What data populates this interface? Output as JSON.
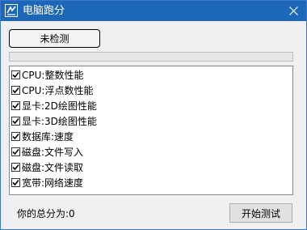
{
  "window": {
    "title": "电脑跑分",
    "app_icon": "app-logo-icon",
    "close_icon": "close-icon"
  },
  "status_button": {
    "label": "未检测"
  },
  "progress": {
    "value_fraction": 0
  },
  "tests": [
    {
      "label": "CPU:整数性能",
      "checked": true
    },
    {
      "label": "CPU:浮点数性能",
      "checked": true
    },
    {
      "label": "显卡:2D绘图性能",
      "checked": true
    },
    {
      "label": "显卡:3D绘图性能",
      "checked": true
    },
    {
      "label": "数据库:速度",
      "checked": true
    },
    {
      "label": "磁盘:文件写入",
      "checked": true
    },
    {
      "label": "磁盘:文件读取",
      "checked": true
    },
    {
      "label": "宽带:网络速度",
      "checked": true
    }
  ],
  "footer": {
    "score_text": "你的总分为:0",
    "start_label": "开始测试"
  },
  "colors": {
    "titlebar": "#1c67b8",
    "window_bg": "#f0f0f0",
    "list_bg": "#ffffff"
  }
}
